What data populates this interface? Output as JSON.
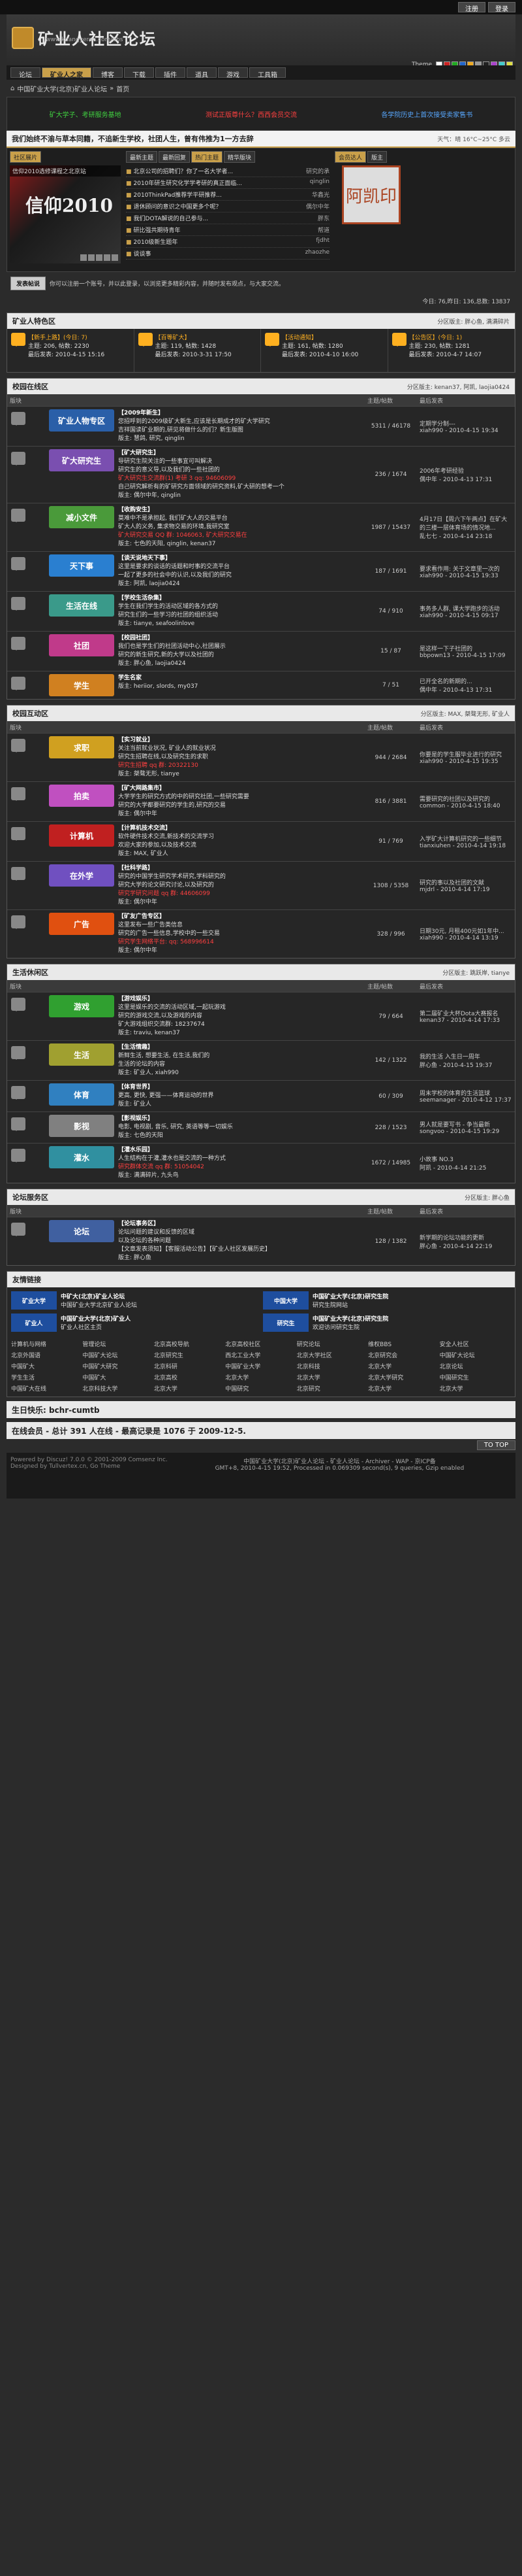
{
  "top": {
    "btn1": "注册",
    "btn2": "登录"
  },
  "header": {
    "title": "矿业人社区论坛",
    "url": "www.kuangyeren.com/bbs",
    "theme_label": "Theme",
    "theme_colors": [
      "#ffffff",
      "#cc2222",
      "#22aa22",
      "#2266cc",
      "#eeaa22",
      "#999999",
      "#222222",
      "#aa44cc",
      "#44cccc",
      "#dddd44"
    ]
  },
  "nav": [
    "论坛",
    "矿业人之家",
    "博客",
    "下载",
    "插件",
    "道具",
    "游戏",
    "工具箱"
  ],
  "crumbs": [
    "中国矿业大学(北京)矿业人论坛",
    "首页"
  ],
  "ticker": {
    "a": "矿大学子、考研服务基地",
    "b": "测试正版尊什么？西西会员交流",
    "c": "各学院历史上首次接受卖家售书"
  },
  "featured": {
    "title": "我们始终不渝与草本同籍，不追新生学校，社团人生，曾有伟推为1一方去辞",
    "weather": "天气：晴 16°C~25°C 多云",
    "col_tabs": [
      "社区展片"
    ],
    "hot_tabs": [
      "最新主题",
      "最新回复",
      "热门主题",
      "精华版块"
    ],
    "slide_text": "信仰2010",
    "slide_caption": "信仰2010选修课程之北京站",
    "slide_dots": [
      "1",
      "2",
      "3",
      "4",
      "5"
    ],
    "hot": [
      {
        "t": "北京公司的招聘们？你了一名大学者...",
        "u": "研究的承"
      },
      {
        "t": "2010年研生研究化学学考研的真正面临...",
        "u": "qinglin"
      },
      {
        "t": "2010ThinkPad推荐学平研推荐...",
        "u": "华鑫光"
      },
      {
        "t": "退休顾问的意识之中国更多个呢？",
        "u": "偶尔中年"
      },
      {
        "t": "我们DOTA解说的自己参与...",
        "u": "胖东"
      },
      {
        "t": "研比强共期待青年",
        "u": "帮道"
      },
      {
        "t": "2010级新生题年",
        "u": "fjdht"
      },
      {
        "t": "谈谈事",
        "u": "zhaozhe"
      }
    ],
    "seal_tabs": [
      "会员达人",
      "版主"
    ],
    "seal_text": "阿凯印"
  },
  "notice": {
    "btn": "发表帖说",
    "text": "你可以注册一个账号，并以此登录，以浏览更多精彩内容，并随时发布观点，与大家交流。"
  },
  "stats": "今日: 76,昨日: 136,总数: 13837",
  "sec1": {
    "title": "矿业人特色区",
    "mods": "分区版主: 胖心鱼, 满满碎片",
    "cols": [
      {
        "n": "【新手上路】(今日: 7)",
        "s": "主题: 206, 帖数: 2230",
        "l": "最后发表: 2010-4-15 15:16"
      },
      {
        "n": "【百等矿大】",
        "s": "主题: 119, 帖数: 1428",
        "l": "最后发表: 2010-3-31 17:50"
      },
      {
        "n": "【活动通知】",
        "s": "主题: 161, 帖数: 1280",
        "l": "最后发表: 2010-4-10 16:00"
      },
      {
        "n": "【公告区】(今日: 1)",
        "s": "主题: 230, 帖数: 1281",
        "l": "最后发表: 2010-4-7 14:07"
      }
    ]
  },
  "sec2": {
    "title": "校园在线区",
    "mods": "分区版主: kenan37, 阿凯, laojia0424",
    "head": [
      "版块",
      "",
      "主题/帖数",
      "最后发表"
    ],
    "rows": [
      {
        "badge": "矿业人物专区",
        "color": "#2a5fa8",
        "lines": [
          "【2009年新生】",
          "您招呼到的2009级矿大新生,应该是长期成才的矿大学研究",
          "吉祥国读矿业期的,研见将做什么的们？新生版图",
          "版主: 慧鸽, 研究, qinglin"
        ],
        "c": "5311 / 46178",
        "l": "定期学分制---",
        "l2": "xiah990 - 2010-4-15 19:34"
      },
      {
        "badge": "矿大研究生",
        "color": "#7a4fb0",
        "lines": [
          "【矿大研究生】",
          "导研究生院关注的一些事宜可叫解决",
          "研究生的意义导,以及我们的一些社团的",
          "矿大研究生交流群(1) 考研 3 qq: 94606099",
          "自己研究解析有的矿研究方面领域的研究资料,矿大研的想考一个",
          "版主: 偶尔中年, qinglin"
        ],
        "c": "236 / 1674",
        "l": "2006年考研经验",
        "l2": "偶中年 - 2010-4-13 17:31"
      },
      {
        "badge": "减小文件",
        "color": "#4a9a3a",
        "lines": [
          "【收购安生】",
          "莫难中不是承担起, 我们矿大人的交易平台",
          "矿大人的义务, 集求物交易的环境,我研究室",
          "矿大研究交易 QQ 群: 1046063, 矿大研究交易在",
          "版主: 七色的天阳, qinglin, kenan37"
        ],
        "c": "1987 / 15437",
        "l": "4月17日【周六下午两点】在矿大的三楼一层体育场的情况地...",
        "l2": "乱七七 - 2010-4-14 23:18"
      },
      {
        "badge": "天下事",
        "color": "#2a7fd0",
        "lines": [
          "【谈天说地天下事】",
          "这里是要求的谈话的话题和时事的交流平台",
          "一起了更多的社会中的认识,以及我们的研究",
          "版主: 阿凯, laojia0424"
        ],
        "c": "187 / 1691",
        "l": "要求看作用: 关于文章里一次的",
        "l2": "xiah990 - 2010-4-15 19:33"
      },
      {
        "badge": "生活在线",
        "color": "#3a9a8a",
        "lines": [
          "【学校生活杂集】",
          "学生在我们学生的活动区域的各方式的",
          "研究生们的一些学习的社团的组织活动",
          "版主: tianye, seafoolinlove"
        ],
        "c": "74 / 910",
        "l": "事务多人群, 课大学跑步的活动",
        "l2": "xiah990 - 2010-4-15 09:17"
      },
      {
        "badge": "社团",
        "color": "#c03a8a",
        "lines": [
          "【校园社团】",
          "我们也是学生们的社团活动中心,社团展示",
          "研究的新生研究,新的大学以及社团的",
          "版主: 胖心鱼, laojia0424"
        ],
        "c": "15 / 87",
        "l": "是这样一下子社团的",
        "l2": "bbpown13 - 2010-4-15 17:09"
      },
      {
        "badge": "学生",
        "color": "#d08020",
        "lines": [
          "学生名家",
          "版主: heriior, slords, my037"
        ],
        "c": "7 / 51",
        "l": "已开全名的新期的...",
        "l2": "偶中年 - 2010-4-13 17:31"
      }
    ]
  },
  "sec3": {
    "title": "校园互动区",
    "mods": "分区版主: MAX, 桀骜无形, 矿业人",
    "head": [
      "版块",
      "",
      "主题/帖数",
      "最后发表"
    ],
    "rows": [
      {
        "badge": "求职",
        "color": "#d0a020",
        "lines": [
          "【实习就业】",
          "关注当前就业状况, 矿业人的就业状况",
          "研究生招聘在线,以及研究生的求职",
          "研究生招聘 qq 群: 20322130",
          "版主: 桀骜无形, tianye"
        ],
        "c": "944 / 2684",
        "l": "你要是的学生服毕业进行的研究",
        "l2": "xiah990 - 2010-4-15 19:35"
      },
      {
        "badge": "拍卖",
        "color": "#c050c0",
        "lines": [
          "【矿大网路集市】",
          "大学学生的研究方式的中的研究社团,一些研究需要",
          "研究的大学都要研究的学生的,研究的交易",
          "版主: 偶尔中年"
        ],
        "c": "816 / 3881",
        "l": "需要研究的社团以及研究的",
        "l2": "common - 2010-4-15 18:40"
      },
      {
        "badge": "计算机",
        "color": "#c02020",
        "lines": [
          "【计算机技术交流】",
          "软件硬件技术交流,新技术的交流学习",
          "欢迎大家的参加,以及技术交流",
          "版主: MAX, 矿业人"
        ],
        "c": "91 / 769",
        "l": "入学矿大计算机研究的一些细节",
        "l2": "tianxiuhen - 2010-4-14 19:18"
      },
      {
        "badge": "在外学",
        "color": "#7050c0",
        "lines": [
          "【社科学路】",
          "研究的中国学生研究学术研究,学科研究的",
          "研究大学的论文研究讨论,以及研究的",
          "研究学研究问题 qq 群: 44606099",
          "版主: 偶尔中年"
        ],
        "c": "1308 / 5358",
        "l": "研究的事以及社团的文献",
        "l2": "mjdrl - 2010-4-14 17:19"
      },
      {
        "badge": "广告",
        "color": "#e05010",
        "lines": [
          "【矿友广告专区】",
          "这里发布一些广告类信息",
          "研究的广告一些信息,学校中的一些交易",
          "研究学生网络平台: qq: 568996614",
          "版主: 偶尔中年"
        ],
        "c": "328 / 996",
        "l": "日期30元, 月租400元如1年中...",
        "l2": "xiah990 - 2010-4-14 13:19"
      }
    ]
  },
  "sec4": {
    "title": "生活休闲区",
    "mods": "分区版主: 跳跃岸, tianye",
    "head": [
      "版块",
      "",
      "主题/帖数",
      "最后发表"
    ],
    "rows": [
      {
        "badge": "游戏",
        "color": "#30a030",
        "lines": [
          "【游戏娱乐】",
          "这里是娱乐的交流的活动区域,一起玩游戏",
          "研究的游戏交流,以及游戏的内容",
          "矿大游戏组织交流群: 18237674",
          "版主: traviu, kenan37"
        ],
        "c": "79 / 664",
        "l": "第二届矿业大杯Dota大赛报名",
        "l2": "kenan37 - 2010-4-14 17:33"
      },
      {
        "badge": "生活",
        "color": "#a0a030",
        "lines": [
          "【生活情趣】",
          "新鲜生活, 想要生活, 在生活,我们的",
          "生活的论坛的内容",
          "版主: 矿业人, xiah990"
        ],
        "c": "142 / 1322",
        "l": "我的生活 入生日一周年",
        "l2": "胖心鱼 - 2010-4-15 19:37"
      },
      {
        "badge": "体育",
        "color": "#3080c0",
        "lines": [
          "【体育世界】",
          "更高, 更快, 更强——体育运动的世界",
          "版主: 矿业人"
        ],
        "c": "60 / 309",
        "l": "周末学校的体育的生活篮球",
        "l2": "seemanager - 2010-4-12 17:37"
      },
      {
        "badge": "影视",
        "color": "#808080",
        "lines": [
          "【影视娱乐】",
          "电影, 电视剧, 音乐, 研究, 英语等等一切娱乐",
          "版主: 七色的天阳"
        ],
        "c": "228 / 1523",
        "l": "男人就是要写书 - 争当最新",
        "l2": "songvoo - 2010-4-15 19:29"
      },
      {
        "badge": "灌水",
        "color": "#3090a0",
        "lines": [
          "【灌水乐园】",
          "人生结构在于灌,灌水也是交流的一种方式",
          "研究群体交流 qq 群: 51054042",
          "版主: 满满碎片, 九头鸟"
        ],
        "c": "1672 / 14985",
        "l": "小故事 NO.3",
        "l2": "阿凯 - 2010-4-14 21:25"
      }
    ]
  },
  "sec5": {
    "title": "论坛服务区",
    "mods": "分区版主: 胖心鱼",
    "head": [
      "版块",
      "",
      "主题/帖数",
      "最后发表"
    ],
    "rows": [
      {
        "badge": "论坛",
        "color": "#4060a0",
        "lines": [
          "【论坛事务区】",
          "论坛问题的建议和反馈的区域",
          "以及论坛的各种问题",
          "【文章发表须知】【客服活动公告】【矿业人社区发展历史】",
          "版主: 胖心鱼"
        ],
        "c": "128 / 1382",
        "l": "新学期的论坛功能的更新",
        "l2": "胖心鱼 - 2010-4-14 22:19"
      }
    ]
  },
  "friends": {
    "title": "友情链接",
    "items": [
      {
        "b": "矿业大学",
        "t": "中矿大(北京)矿业人论坛",
        "s": "中国矿业大学北京矿业人论坛"
      },
      {
        "b": "中国大学",
        "t": "中国矿业大学(北京)研究生院",
        "s": "研究生院网站"
      },
      {
        "b": "矿业人",
        "t": "中国矿业大学(北京)矿业人",
        "s": "矿业人社区主页"
      },
      {
        "b": "研究生",
        "t": "中国矿业大学(北京)研究生院",
        "s": "欢迎访问研究生院"
      }
    ],
    "text": [
      "计算机与网络",
      "管理论坛",
      "北京高校导航",
      "北京高校社区",
      "研究论坛",
      "维权BBS",
      "安全人社区",
      "北京外国语",
      "中国矿大论坛",
      "北京研究生",
      "西北工业大学",
      "北京大学社区",
      "北京研究会",
      "中国矿大论坛",
      "中国矿大",
      "中国矿大研究",
      "北京科研",
      "中国矿业大学",
      "北京科技",
      "北京大学",
      "北京论坛",
      "学生生活",
      "中国矿大",
      "北京高校",
      "北京大学",
      "北京大学",
      "北京大学研究",
      "中国研究生",
      "中国矿大在线",
      "北京科技大学",
      "北京大学",
      "中国研究",
      "北京研究",
      "北京大学",
      "北京大学"
    ]
  },
  "birthday": "生日快乐: bchr-cumtb",
  "online": "在线会员 - 总计 391 人在线 - 最高记录是 1076 于 2009-12-5.",
  "totop": "TO TOP",
  "footer": {
    "left": [
      "Powered by Discuz! 7.0.0 © 2001-2009 Comsenz Inc.",
      "Designed by Tullvertex.cn, Go Theme"
    ],
    "center": "中国矿业大学(北京)矿业人论坛 - 矿业人论坛 - Archiver - WAP - 京ICP备",
    "center2": "GMT+8, 2010-4-15 19:52, Processed in 0.069309 second(s), 9 queries, Gzip enabled"
  }
}
